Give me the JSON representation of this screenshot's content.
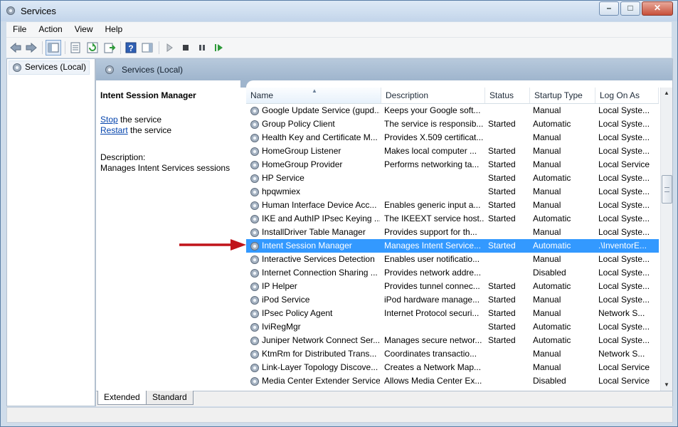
{
  "window": {
    "title": "Services"
  },
  "menu": [
    "File",
    "Action",
    "Help"
  ],
  "menu_view": "View",
  "tree": {
    "root_label": "Services (Local)"
  },
  "pane": {
    "header": "Services (Local)"
  },
  "details": {
    "service_name": "Intent Session Manager",
    "stop_link": "Stop",
    "stop_suffix": " the service",
    "restart_link": "Restart",
    "restart_suffix": " the service",
    "description_label": "Description:",
    "description_text": "Manages Intent Services sessions"
  },
  "columns": [
    "Name",
    "Description",
    "Status",
    "Startup Type",
    "Log On As"
  ],
  "rows": [
    {
      "name": "Google Update Service (gupd...",
      "desc": "Keeps your Google soft...",
      "status": "",
      "startup": "Manual",
      "logon": "Local Syste..."
    },
    {
      "name": "Group Policy Client",
      "desc": "The service is responsib...",
      "status": "Started",
      "startup": "Automatic",
      "logon": "Local Syste..."
    },
    {
      "name": "Health Key and Certificate M...",
      "desc": "Provides X.509 certificat...",
      "status": "",
      "startup": "Manual",
      "logon": "Local Syste..."
    },
    {
      "name": "HomeGroup Listener",
      "desc": "Makes local computer ...",
      "status": "Started",
      "startup": "Manual",
      "logon": "Local Syste..."
    },
    {
      "name": "HomeGroup Provider",
      "desc": "Performs networking ta...",
      "status": "Started",
      "startup": "Manual",
      "logon": "Local Service"
    },
    {
      "name": "HP Service",
      "desc": "",
      "status": "Started",
      "startup": "Automatic",
      "logon": "Local Syste..."
    },
    {
      "name": "hpqwmiex",
      "desc": "",
      "status": "Started",
      "startup": "Manual",
      "logon": "Local Syste..."
    },
    {
      "name": "Human Interface Device Acc...",
      "desc": "Enables generic input a...",
      "status": "Started",
      "startup": "Manual",
      "logon": "Local Syste..."
    },
    {
      "name": "IKE and AuthIP IPsec Keying ...",
      "desc": "The IKEEXT service host...",
      "status": "Started",
      "startup": "Automatic",
      "logon": "Local Syste..."
    },
    {
      "name": "InstallDriver Table Manager",
      "desc": "Provides support for th...",
      "status": "",
      "startup": "Manual",
      "logon": "Local Syste..."
    },
    {
      "name": "Intent Session Manager",
      "desc": "Manages Intent Service...",
      "status": "Started",
      "startup": "Automatic",
      "logon": ".\\InventorE..."
    },
    {
      "name": "Interactive Services Detection",
      "desc": "Enables user notificatio...",
      "status": "",
      "startup": "Manual",
      "logon": "Local Syste..."
    },
    {
      "name": "Internet Connection Sharing ...",
      "desc": "Provides network addre...",
      "status": "",
      "startup": "Disabled",
      "logon": "Local Syste..."
    },
    {
      "name": "IP Helper",
      "desc": "Provides tunnel connec...",
      "status": "Started",
      "startup": "Automatic",
      "logon": "Local Syste..."
    },
    {
      "name": "iPod Service",
      "desc": "iPod hardware manage...",
      "status": "Started",
      "startup": "Manual",
      "logon": "Local Syste..."
    },
    {
      "name": "IPsec Policy Agent",
      "desc": "Internet Protocol securi...",
      "status": "Started",
      "startup": "Manual",
      "logon": "Network S..."
    },
    {
      "name": "IviRegMgr",
      "desc": "",
      "status": "Started",
      "startup": "Automatic",
      "logon": "Local Syste..."
    },
    {
      "name": "Juniper Network Connect Ser...",
      "desc": "Manages secure networ...",
      "status": "Started",
      "startup": "Automatic",
      "logon": "Local Syste..."
    },
    {
      "name": "KtmRm for Distributed Trans...",
      "desc": "Coordinates transactio...",
      "status": "",
      "startup": "Manual",
      "logon": "Network S..."
    },
    {
      "name": "Link-Layer Topology Discove...",
      "desc": "Creates a Network Map...",
      "status": "",
      "startup": "Manual",
      "logon": "Local Service"
    },
    {
      "name": "Media Center Extender Service",
      "desc": "Allows Media Center Ex...",
      "status": "",
      "startup": "Disabled",
      "logon": "Local Service"
    }
  ],
  "selected_row": 10,
  "tabs": [
    "Extended",
    "Standard"
  ],
  "colors": {
    "selection": "#3399ff",
    "annotation_arrow": "#c0141a",
    "link": "#0645ad"
  }
}
